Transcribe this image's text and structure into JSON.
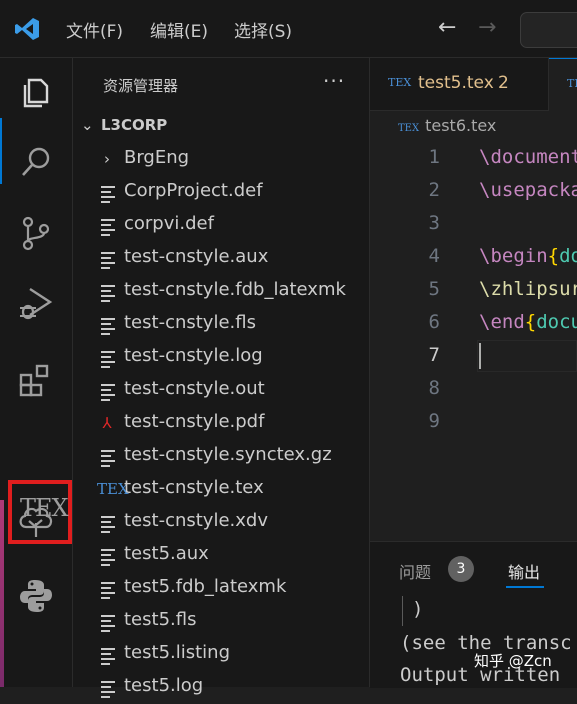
{
  "titlebar": {
    "menu": [
      "文件(F)",
      "编辑(E)",
      "选择(S)"
    ],
    "back": "←",
    "forward": "→"
  },
  "activitybar": {
    "icons": [
      "explorer-icon",
      "search-icon",
      "source-control-icon",
      "run-debug-icon",
      "extensions-icon",
      "tex-icon",
      "tree-icon",
      "python-icon"
    ],
    "tex_label": "TEX"
  },
  "sidebar": {
    "title": "资源管理器",
    "more": "···",
    "root": "L3CORP",
    "items": [
      {
        "label": "BrgEng",
        "icon": "folder"
      },
      {
        "label": "CorpProject.def",
        "icon": "lines"
      },
      {
        "label": "corpvi.def",
        "icon": "lines"
      },
      {
        "label": "test-cnstyle.aux",
        "icon": "lines"
      },
      {
        "label": "test-cnstyle.fdb_latexmk",
        "icon": "lines"
      },
      {
        "label": "test-cnstyle.fls",
        "icon": "lines"
      },
      {
        "label": "test-cnstyle.log",
        "icon": "lines"
      },
      {
        "label": "test-cnstyle.out",
        "icon": "lines"
      },
      {
        "label": "test-cnstyle.pdf",
        "icon": "pdf"
      },
      {
        "label": "test-cnstyle.synctex.gz",
        "icon": "lines"
      },
      {
        "label": "test-cnstyle.tex",
        "icon": "tex"
      },
      {
        "label": "test-cnstyle.xdv",
        "icon": "lines"
      },
      {
        "label": "test5.aux",
        "icon": "lines"
      },
      {
        "label": "test5.fdb_latexmk",
        "icon": "lines"
      },
      {
        "label": "test5.fls",
        "icon": "lines"
      },
      {
        "label": "test5.listing",
        "icon": "lines"
      },
      {
        "label": "test5.log",
        "icon": "lines"
      }
    ]
  },
  "editor": {
    "tab_active": {
      "label": "test5.tex",
      "problems": "2"
    },
    "breadcrumb": "test6.tex",
    "line_numbers": [
      "1",
      "2",
      "3",
      "4",
      "5",
      "6",
      "7",
      "8",
      "9"
    ],
    "code": {
      "line1_cmd": "\\document",
      "line2_cmd": "\\usepacka",
      "line4_cmd": "\\begin",
      "line4_arg": "do",
      "line5_cmd": "\\zhlipsur",
      "line6_cmd": "\\end",
      "line6_arg": "docu"
    }
  },
  "panel": {
    "tab_problems": "问题",
    "problems_count": "3",
    "tab_output": "输出",
    "output_lines": [
      ")",
      "(see the transc",
      "Output written"
    ]
  },
  "watermark": "知乎 @Zcn"
}
